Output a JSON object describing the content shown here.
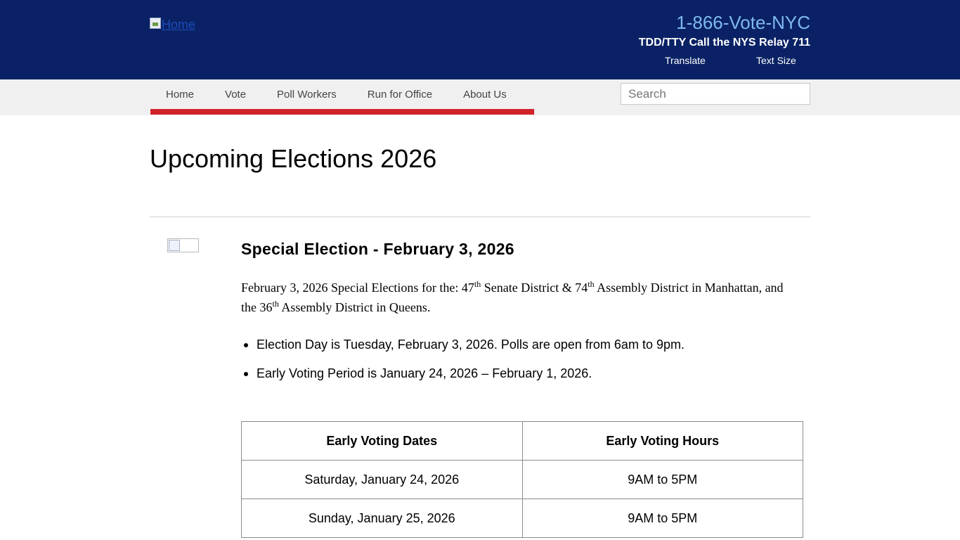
{
  "header": {
    "logo_alt": "Home",
    "phone": "1-866-Vote-NYC",
    "relay": "TDD/TTY Call the NYS Relay 711",
    "translate_label": "Translate",
    "text_size_label": "Text Size"
  },
  "nav": {
    "items": [
      "Home",
      "Vote",
      "Poll Workers",
      "Run for Office",
      "About Us"
    ],
    "search_placeholder": "Search"
  },
  "colors": {
    "header_bg": "#0a2265",
    "phone_text": "#7fb8f0",
    "nav_accent": "#d1222a",
    "nav_bg": "#f0f0f0"
  },
  "page": {
    "title": "Upcoming Elections 2026"
  },
  "election": {
    "title": "Special Election - February 3, 2026",
    "intro": {
      "p1": "February 3, 2026 Special Elections for the: 47",
      "sup1": "th",
      "p2": " Senate District & 74",
      "sup2": "th",
      "p3": " Assembly District in Manhattan, and the 36",
      "sup3": "th",
      "p4": " Assembly District in Queens."
    },
    "bullets": [
      "Election Day is Tuesday, February 3, 2026. Polls are open from 6am to 9pm.",
      "Early Voting Period is January 24, 2026 – February 1, 2026."
    ],
    "table": {
      "headers": [
        "Early Voting Dates",
        "Early Voting Hours"
      ],
      "rows": [
        [
          "Saturday, January 24, 2026",
          "9AM to 5PM"
        ],
        [
          "Sunday, January 25, 2026",
          "9AM to 5PM"
        ]
      ]
    }
  }
}
